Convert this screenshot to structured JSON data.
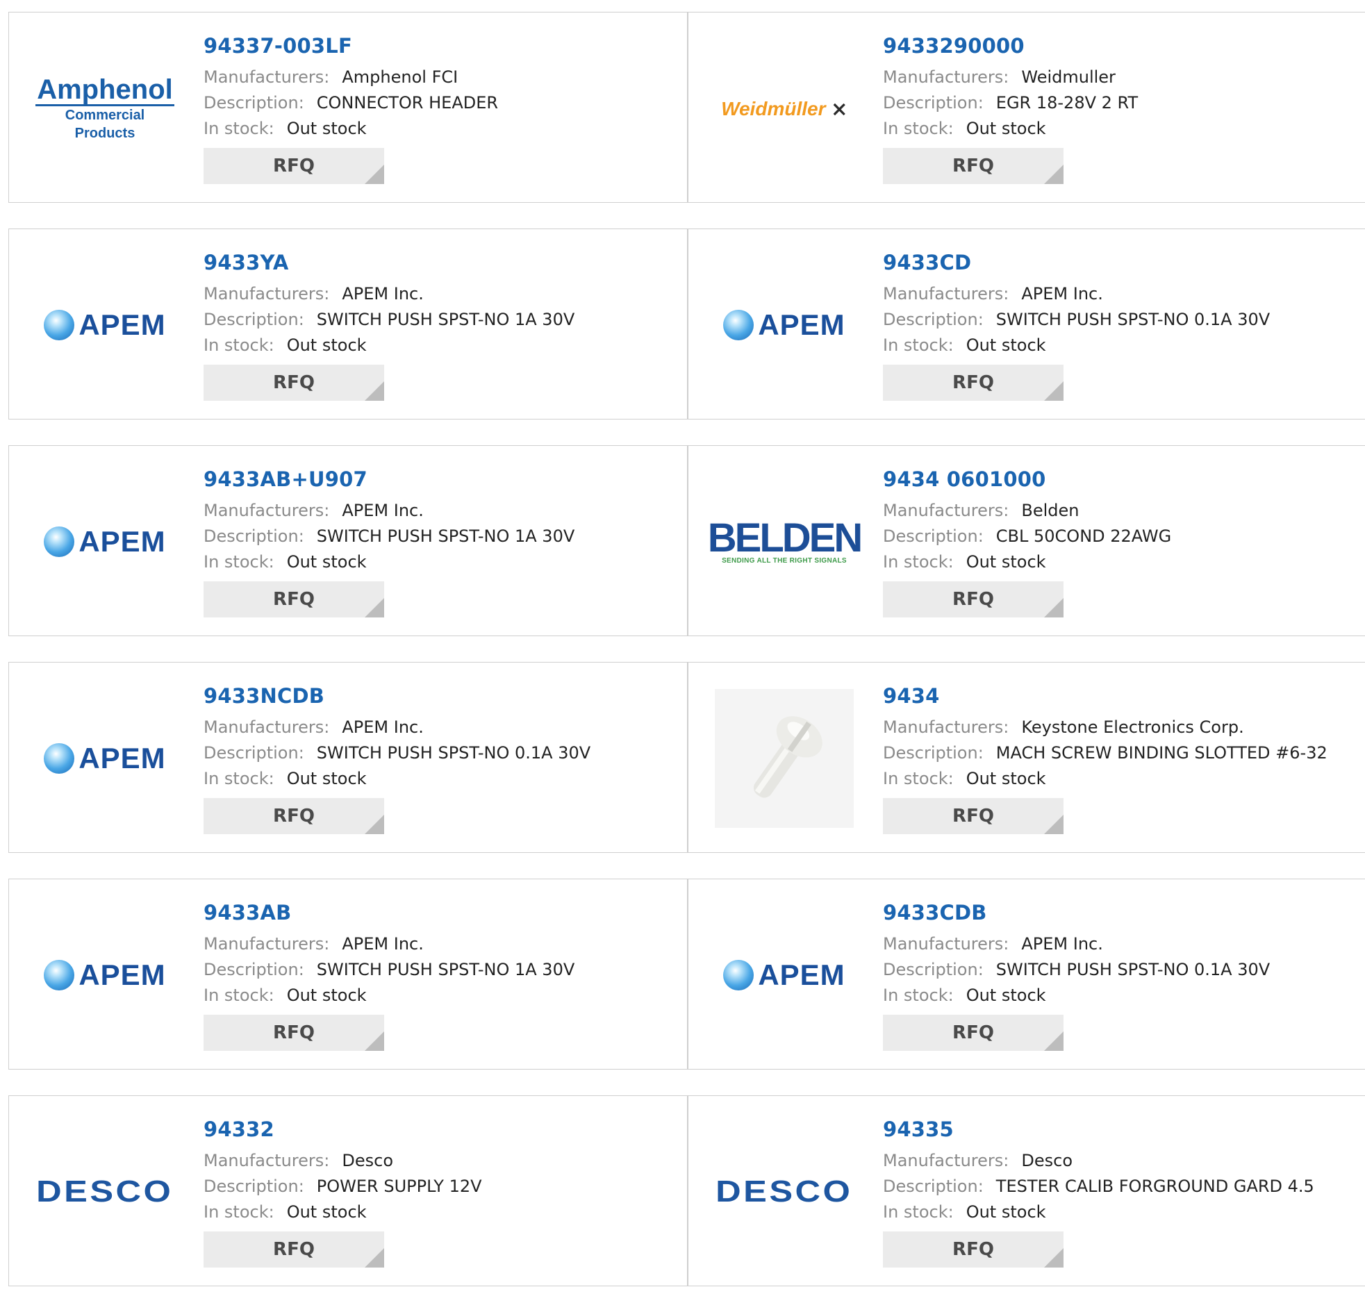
{
  "labels": {
    "manufacturers": "Manufacturers:",
    "description": "Description:",
    "in_stock": "In stock:",
    "rfq": "RFQ"
  },
  "colors": {
    "part_link": "#1a64b0",
    "label": "#8a8a8a",
    "rfq_bg": "#ebebeb"
  },
  "products": [
    {
      "part": "94337-003LF",
      "manufacturer": "Amphenol FCI",
      "description": "CONNECTOR HEADER",
      "stock": "Out stock",
      "logo": "amphenol",
      "logo_text": [
        "Amphenol",
        "Commercial Products"
      ]
    },
    {
      "part": "9433290000",
      "manufacturer": "Weidmuller",
      "description": "EGR 18-28V 2 RT",
      "stock": "Out stock",
      "logo": "weidmuller",
      "logo_text": [
        "Weidmüller"
      ]
    },
    {
      "part": "9433YA",
      "manufacturer": "APEM Inc.",
      "description": "SWITCH PUSH SPST-NO 1A 30V",
      "stock": "Out stock",
      "logo": "apem",
      "logo_text": [
        "APEM"
      ]
    },
    {
      "part": "9433CD",
      "manufacturer": "APEM Inc.",
      "description": "SWITCH PUSH SPST-NO 0.1A 30V",
      "stock": "Out stock",
      "logo": "apem",
      "logo_text": [
        "APEM"
      ]
    },
    {
      "part": "9433AB+U907",
      "manufacturer": "APEM Inc.",
      "description": "SWITCH PUSH SPST-NO 1A 30V",
      "stock": "Out stock",
      "logo": "apem",
      "logo_text": [
        "APEM"
      ]
    },
    {
      "part": "9434 0601000",
      "manufacturer": "Belden",
      "description": "CBL 50COND 22AWG",
      "stock": "Out stock",
      "logo": "belden",
      "logo_text": [
        "BELDEN",
        "SENDING ALL THE RIGHT SIGNALS"
      ]
    },
    {
      "part": "9433NCDB",
      "manufacturer": "APEM Inc.",
      "description": "SWITCH PUSH SPST-NO 0.1A 30V",
      "stock": "Out stock",
      "logo": "apem",
      "logo_text": [
        "APEM"
      ]
    },
    {
      "part": "9434",
      "manufacturer": "Keystone Electronics Corp.",
      "description": "MACH SCREW BINDING SLOTTED #6-32",
      "stock": "Out stock",
      "logo": "screw-photo",
      "logo_text": []
    },
    {
      "part": "9433AB",
      "manufacturer": "APEM Inc.",
      "description": "SWITCH PUSH SPST-NO 1A 30V",
      "stock": "Out stock",
      "logo": "apem",
      "logo_text": [
        "APEM"
      ]
    },
    {
      "part": "9433CDB",
      "manufacturer": "APEM Inc.",
      "description": "SWITCH PUSH SPST-NO 0.1A 30V",
      "stock": "Out stock",
      "logo": "apem",
      "logo_text": [
        "APEM"
      ]
    },
    {
      "part": "94332",
      "manufacturer": "Desco",
      "description": "POWER SUPPLY 12V",
      "stock": "Out stock",
      "logo": "desco",
      "logo_text": [
        "DESCO"
      ]
    },
    {
      "part": "94335",
      "manufacturer": "Desco",
      "description": "TESTER CALIB FORGROUND GARD 4.5",
      "stock": "Out stock",
      "logo": "desco",
      "logo_text": [
        "DESCO"
      ]
    }
  ]
}
